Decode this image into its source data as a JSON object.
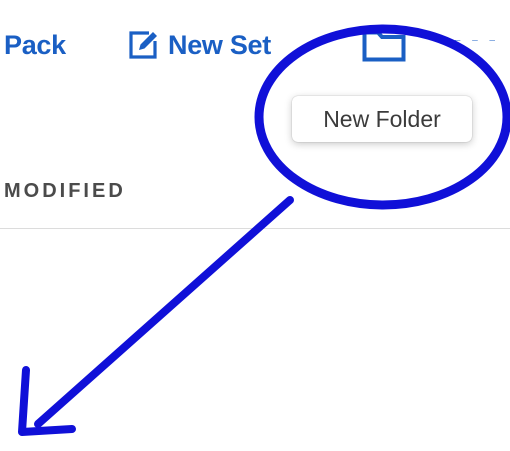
{
  "theme": {
    "accent": "#1a5fc4",
    "annotation": "#1010d8"
  },
  "toolbar": {
    "pack_label": "Pack",
    "new_set_label": "New Set",
    "new_set_icon": "edit-icon",
    "folder_icon": "folder-icon",
    "more_icon": "more-icon",
    "more_label": "···"
  },
  "tooltip": {
    "text": "New Folder"
  },
  "table": {
    "columns": [
      "MODIFIED"
    ]
  },
  "annotation": {
    "shape": "ellipse-highlight",
    "pointer": "arrow-down-left"
  }
}
